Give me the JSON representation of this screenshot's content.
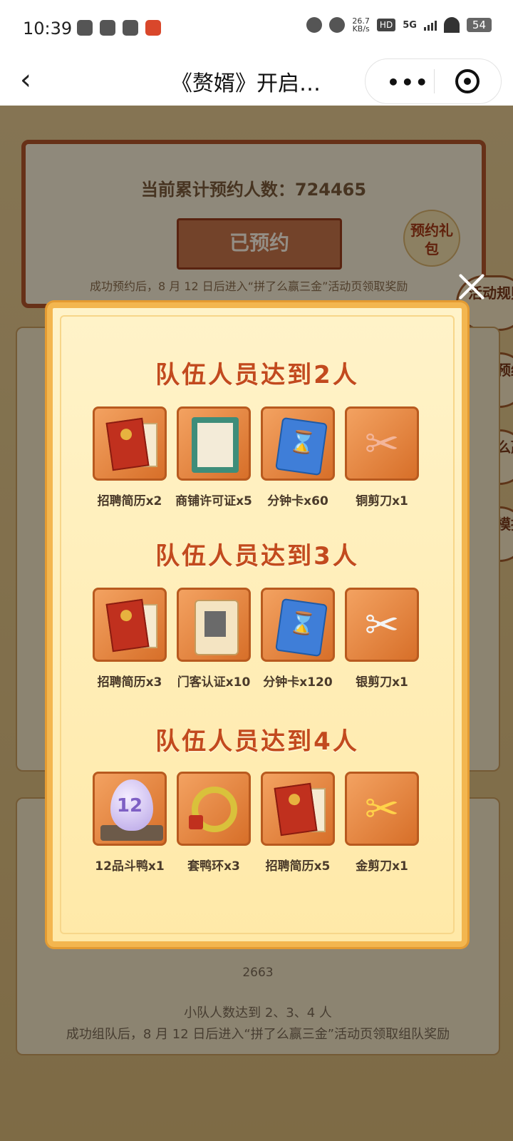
{
  "status_bar": {
    "time": "10:39",
    "net_speed_value": "26.7",
    "net_speed_unit": "KB/s",
    "hd": "HD",
    "network": "5G",
    "battery": "54"
  },
  "nav": {
    "back_icon": "‹",
    "title": "《赘婿》开启…",
    "more_icon": "•••"
  },
  "background": {
    "reserve_count_label": "当前累计预约人数：724465",
    "reserved_button": "已预约",
    "reserve_note": "成功预约后，8 月 12 日后进入“拼了么赢三金”活动页领取奖励",
    "gift_badge": "预约礼包",
    "side_tabs": [
      "活动规则",
      "官方预约群",
      "拼了么赢三金",
      "赘婿模拟器"
    ],
    "team_count": "2663",
    "team_note_1": "小队人数达到 2、3、4 人",
    "team_note_2": "成功组队后，8 月 12 日后进入“拼了么赢三金”活动页领取组队奖励"
  },
  "modal": {
    "tiers": [
      {
        "title": "队伍人员达到2人",
        "items": [
          {
            "label": "招聘简历x2",
            "icon": "resume-icon"
          },
          {
            "label": "商铺许可证x5",
            "icon": "license-icon"
          },
          {
            "label": "分钟卡x60",
            "icon": "minute-card-icon"
          },
          {
            "label": "铜剪刀x1",
            "icon": "copper-scissors-icon"
          }
        ]
      },
      {
        "title": "队伍人员达到3人",
        "items": [
          {
            "label": "招聘简历x3",
            "icon": "resume-icon"
          },
          {
            "label": "门客认证x10",
            "icon": "retainer-badge-icon"
          },
          {
            "label": "分钟卡x120",
            "icon": "minute-card-icon"
          },
          {
            "label": "银剪刀x1",
            "icon": "silver-scissors-icon"
          }
        ]
      },
      {
        "title": "队伍人员达到4人",
        "items": [
          {
            "label": "12品斗鸭x1",
            "icon": "duck-egg-icon",
            "badge": "12"
          },
          {
            "label": "套鸭环x3",
            "icon": "ring-icon"
          },
          {
            "label": "招聘简历x5",
            "icon": "resume-icon"
          },
          {
            "label": "金剪刀x1",
            "icon": "gold-scissors-icon"
          }
        ]
      }
    ]
  }
}
